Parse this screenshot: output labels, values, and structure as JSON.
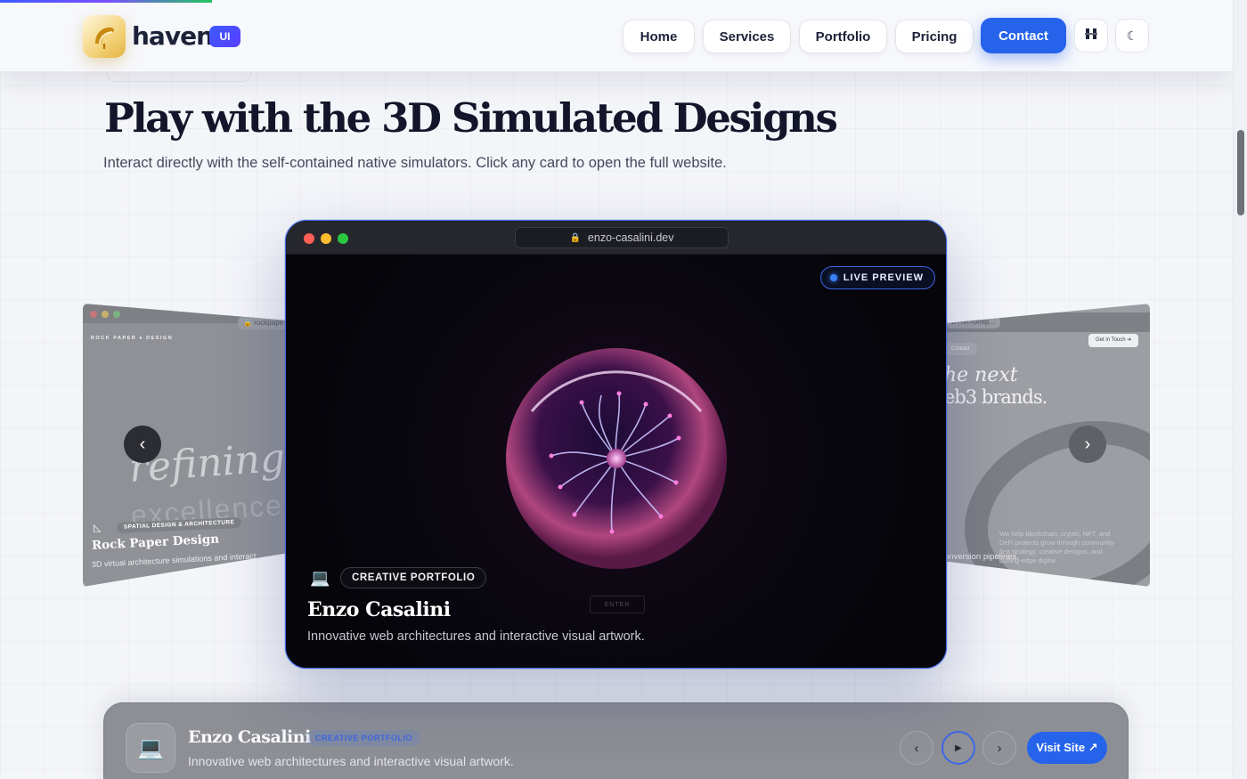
{
  "brand": {
    "name": "haven",
    "badge": "UI"
  },
  "nav": {
    "items": [
      {
        "label": "Home"
      },
      {
        "label": "Services"
      },
      {
        "label": "Portfolio"
      },
      {
        "label": "Pricing"
      }
    ],
    "contact_label": "Contact",
    "accent_color": "#2563eb"
  },
  "hero": {
    "title": "Play with the 3D Simulated Designs",
    "subtitle": "Interact directly with the self-contained native simulators. Click any card to open the full website."
  },
  "carousel": {
    "left_card": {
      "url": "rockpape",
      "brand_line": "ROCK PAPER ● DESIGN",
      "hero_word_1": "refining",
      "hero_word_2": "excellence",
      "tag": "SPATIAL DESIGN & ARCHITECTURE",
      "title": "Rock Paper Design",
      "description": "3D virtual architecture simulations and interact"
    },
    "main_card": {
      "url": "enzo-casalini.dev",
      "live_badge": "LIVE PREVIEW",
      "category": "CREATIVE PORTFOLIO",
      "enter_label": "ENTER",
      "title": "Enzo Casalini",
      "description": "Innovative web architectures and interactive visual artwork."
    },
    "right_card": {
      "url": "z/?ref=onep...",
      "contact_label": "Contact",
      "cta": "Get in Touch",
      "headline_1": "he next",
      "headline_2": "eb3 brands.",
      "body": "We help blockchain, crypto, NFT, and DeFi projects grow through community-first strategy, creative designs, and cutting-edge digital",
      "bottom_line": "onversion pipelines."
    }
  },
  "detail_panel": {
    "title": "Enzo Casalini",
    "tag": "CREATIVE PORTFOLIO",
    "description": "Innovative web architectures and interactive visual artwork.",
    "visit_label": "Visit Site ↗"
  },
  "icons": {
    "logo": "shell-logo-icon",
    "grid": "grid-toggle-icon",
    "theme": "moon-icon",
    "prev": "chevron-left-icon",
    "next": "chevron-right-icon",
    "play": "play-icon",
    "laptop": "laptop-icon",
    "lock": "lock-icon"
  }
}
